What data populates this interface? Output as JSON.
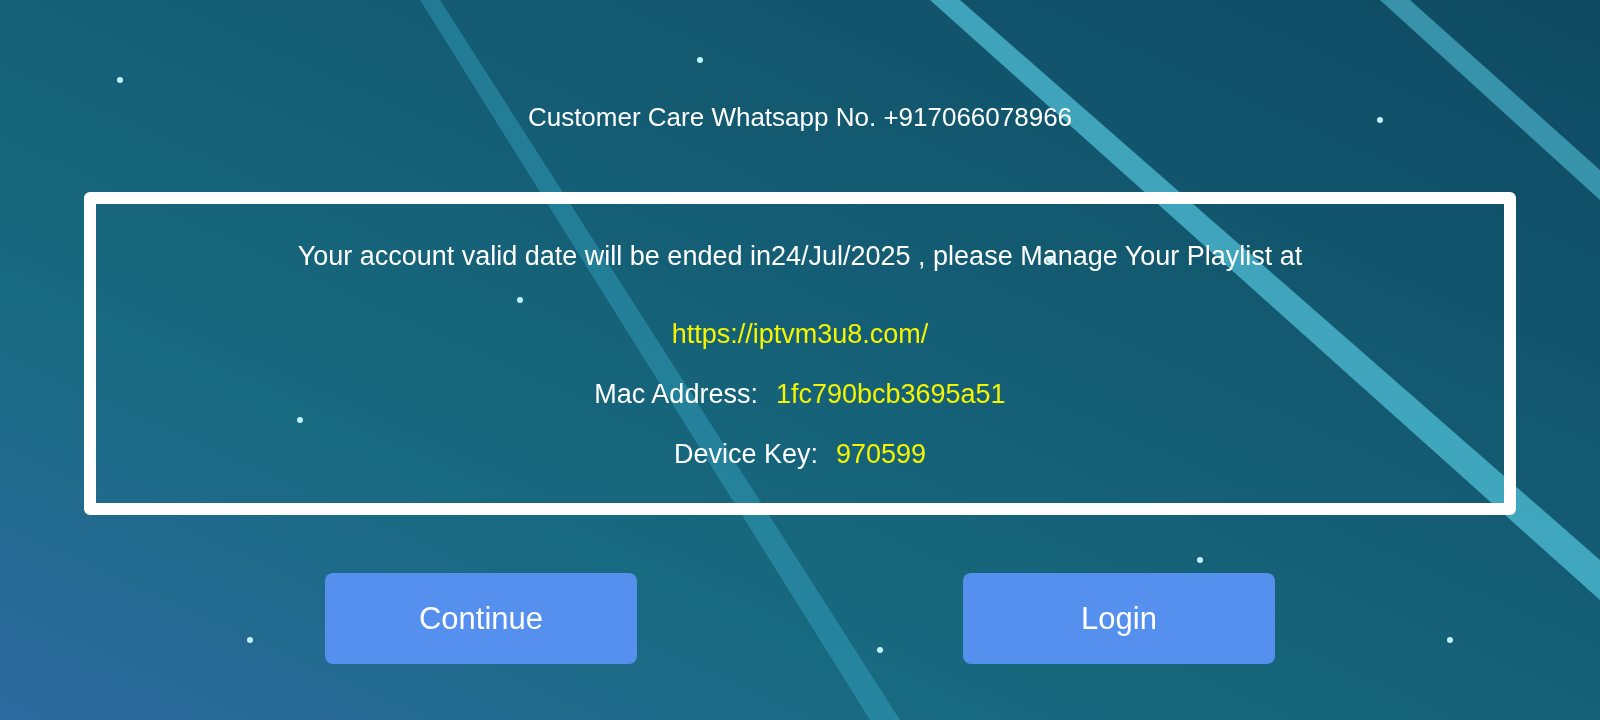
{
  "customer_care": "Customer Care Whatsapp No. +917066078966",
  "notice": {
    "message": "Your account valid date will be ended in24/Jul/2025 , please Manage Your Playlist at",
    "link": "https://iptvm3u8.com/",
    "fields": [
      {
        "label": "Mac Address:",
        "value": "1fc790bcb3695a51"
      },
      {
        "label": "Device Key:",
        "value": "970599"
      }
    ]
  },
  "buttons": [
    "Continue",
    "Login"
  ]
}
